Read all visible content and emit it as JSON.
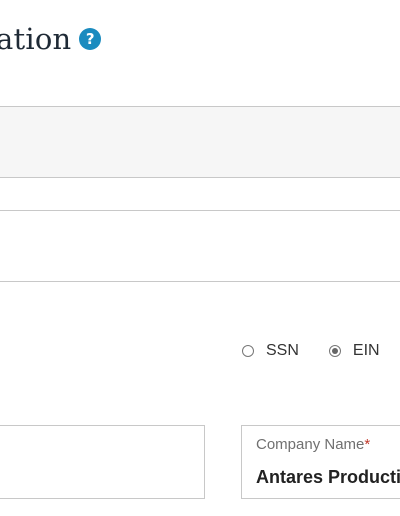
{
  "header": {
    "title_fragment": "ation",
    "help_icon_glyph": "?"
  },
  "tax_id_type": {
    "options": [
      {
        "label": "SSN",
        "checked": false
      },
      {
        "label": "EIN",
        "checked": true
      }
    ]
  },
  "company_name": {
    "label": "Company Name",
    "required_marker": "*",
    "value": "Antares Productions"
  },
  "colors": {
    "help_icon": "#1a8bbf",
    "required_marker": "#c0392b",
    "border": "#c8c8c8"
  }
}
